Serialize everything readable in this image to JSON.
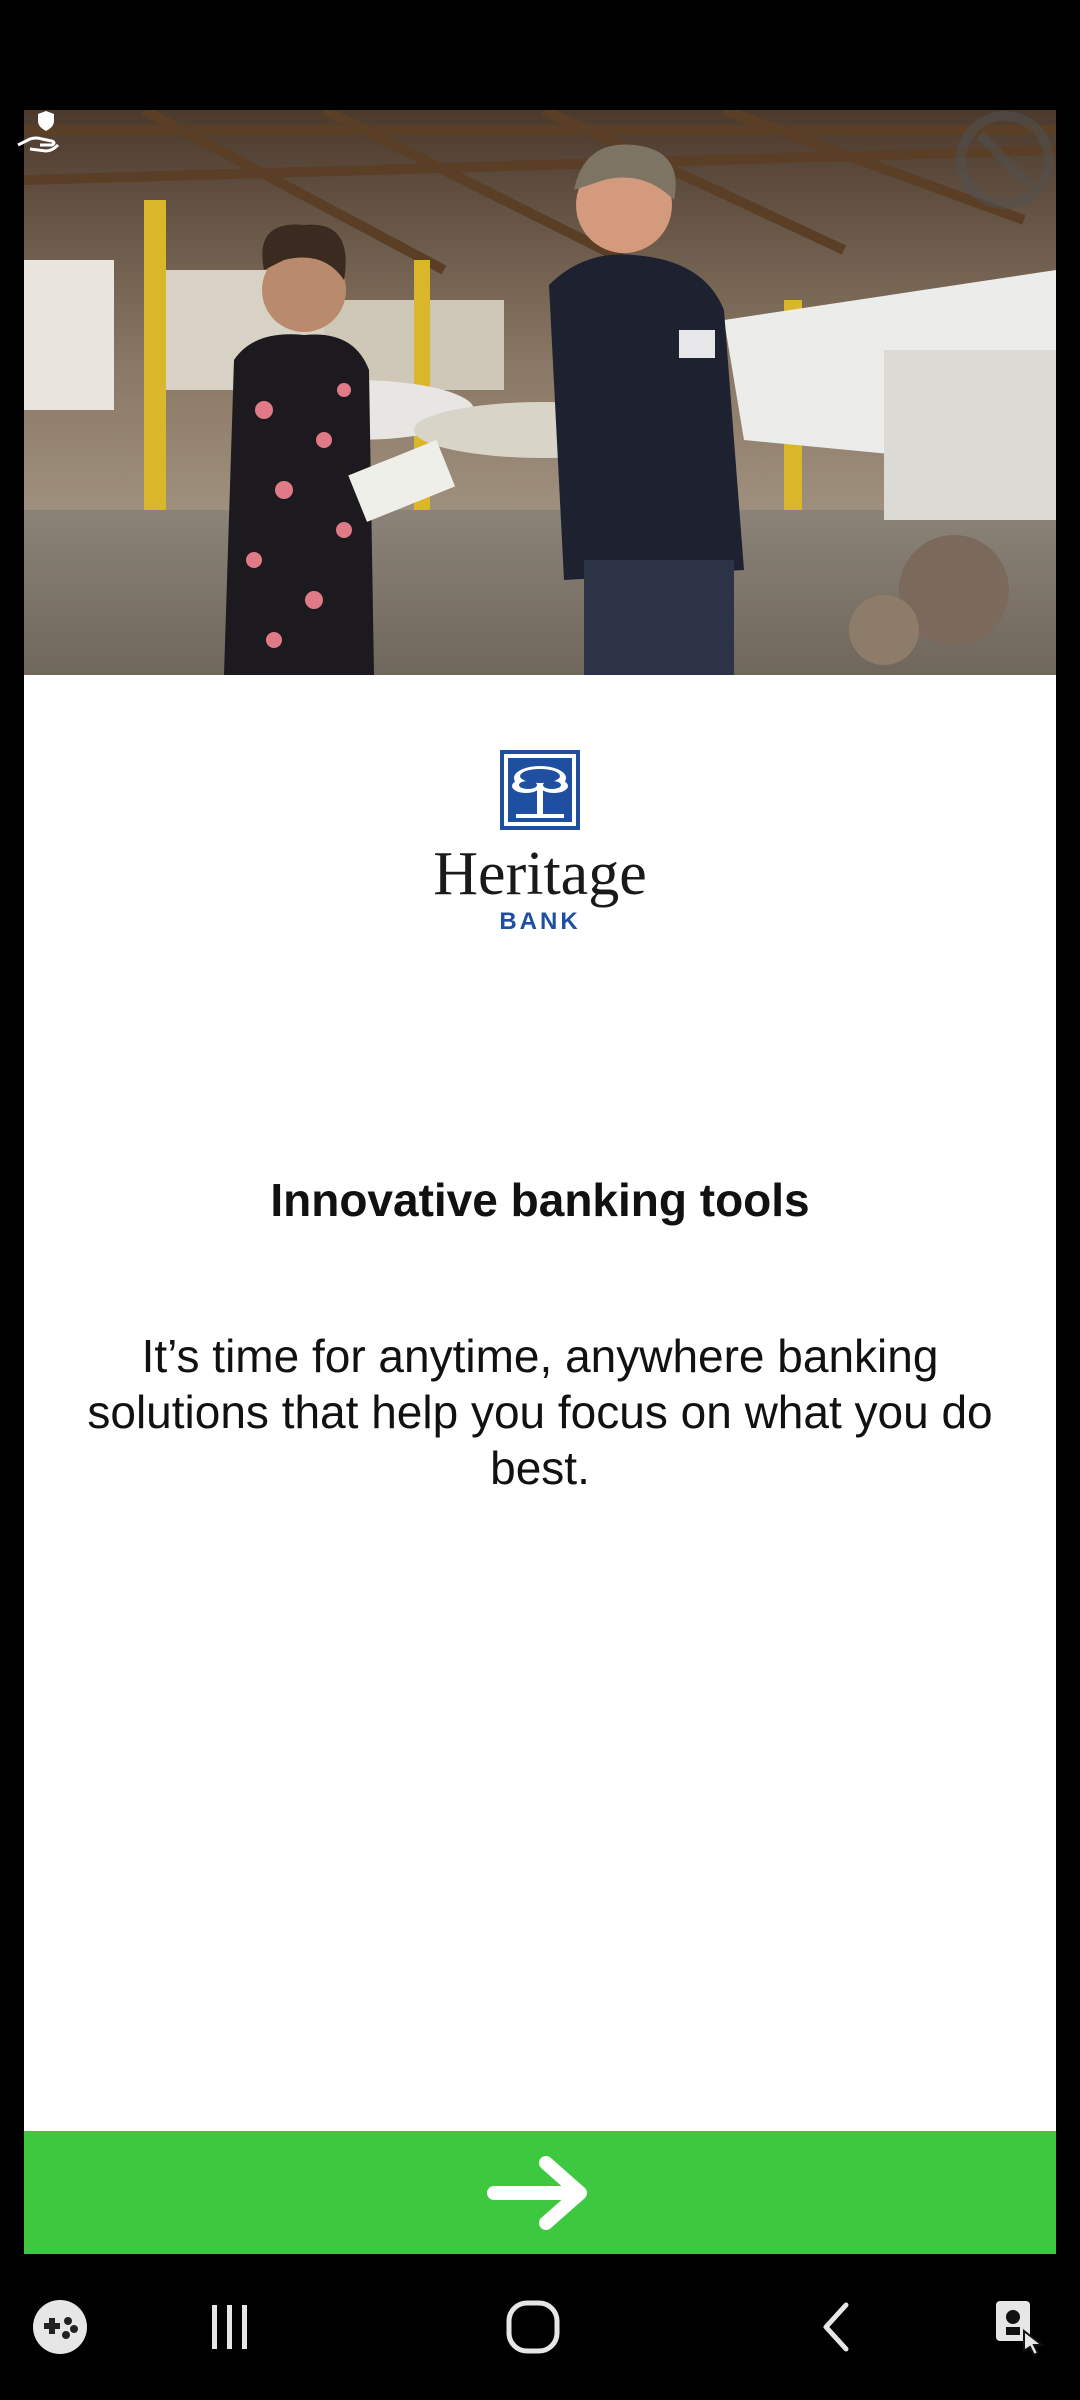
{
  "brand": {
    "name": "Heritage",
    "sub": "BANK",
    "color": "#1e4fa0"
  },
  "onboarding": {
    "headline": "Innovative banking tools",
    "body": "It’s time for anytime, anywhere banking solutions that help you focus on what you do best."
  },
  "next_button": {
    "icon": "arrow-right-icon",
    "color": "#3dc83f"
  },
  "nav_bar": {
    "items": [
      "game-launcher-icon",
      "recent-apps-icon",
      "home-icon",
      "back-icon",
      "accessibility-icon"
    ]
  }
}
